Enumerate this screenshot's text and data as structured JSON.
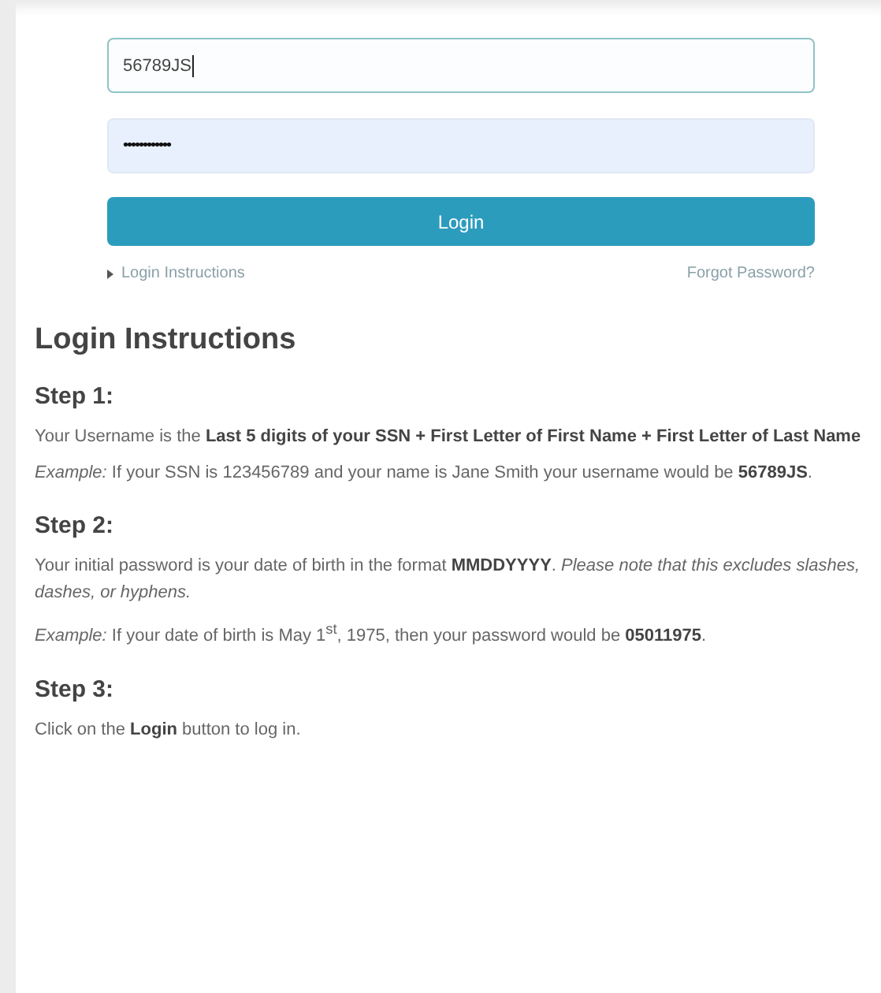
{
  "login_form": {
    "username": "56789JS",
    "password_mask": "••••••••••••",
    "login_button": "Login",
    "instructions_link": "Login Instructions",
    "forgot_link": "Forgot Password?"
  },
  "instructions": {
    "title": "Login Instructions",
    "steps": [
      {
        "heading": "Step 1:",
        "paragraphs": [
          "Your Username is the **Last 5 digits of your SSN + First Letter of First Name + First Letter of Last Name**",
          "*Example:* If your SSN is 123456789 and your name is Jane Smith your username would be **56789JS**."
        ]
      },
      {
        "heading": "Step 2:",
        "paragraphs": [
          "Your initial password is your date of birth in the format **MMDDYYYY**. *Please note that this excludes slashes, dashes, or hyphens.*",
          "*Example:* If your date of birth is May 1$^{st}$, 1975, then your password would be **05011975**."
        ]
      },
      {
        "heading": "Step 3:",
        "paragraphs": [
          "Click on the **Login** button to log in."
        ]
      }
    ]
  }
}
